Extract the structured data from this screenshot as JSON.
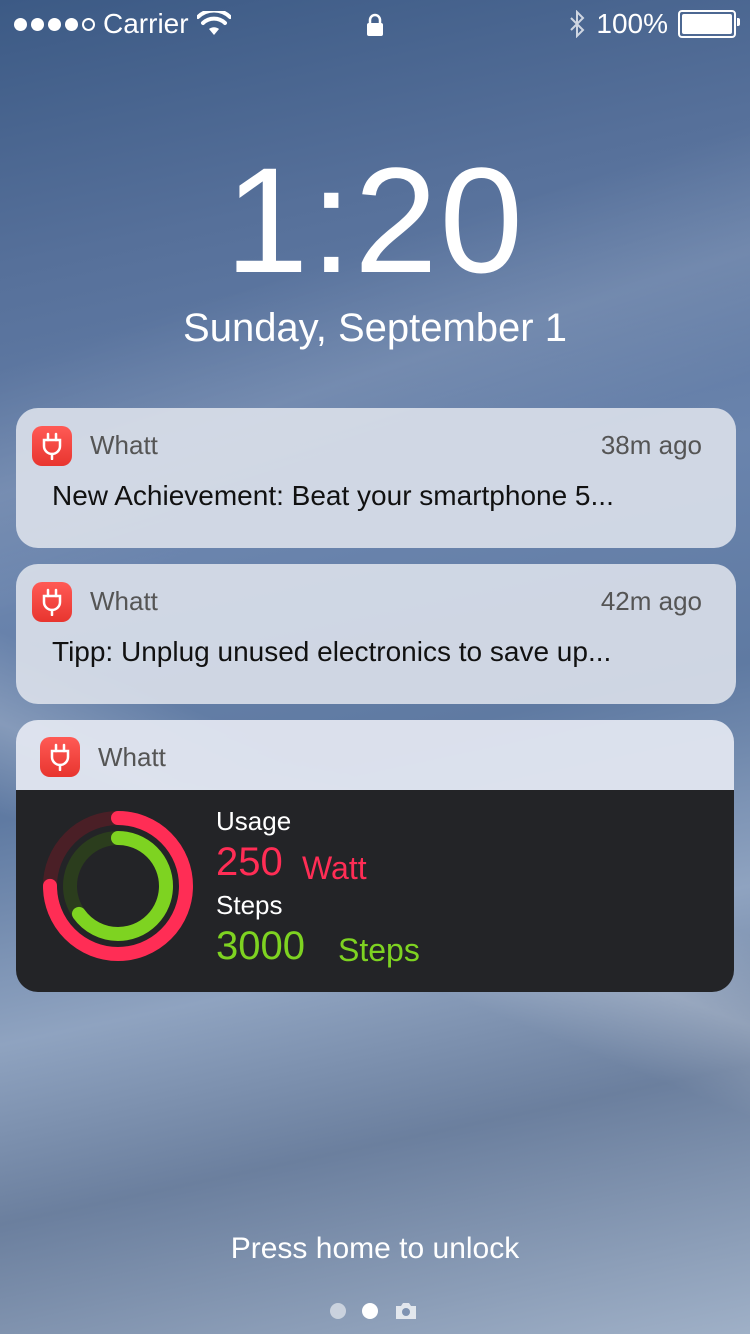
{
  "status_bar": {
    "carrier": "Carrier",
    "battery": "100%",
    "signal_bars": 4,
    "signal_total": 5
  },
  "lock": {
    "time": "1:20",
    "date": "Sunday, September 1",
    "unlock_hint": "Press home to unlock"
  },
  "notifications": [
    {
      "app": "Whatt",
      "time": "38m ago",
      "message": "New Achievement: Beat your smartphone 5..."
    },
    {
      "app": "Whatt",
      "time": "42m ago",
      "message": "Tipp: Unplug unused electronics to save up..."
    }
  ],
  "widget": {
    "app": "Whatt",
    "usage_label": "Usage",
    "usage_value": "250",
    "usage_unit": "Watt",
    "steps_label": "Steps",
    "steps_value": "3000",
    "steps_unit": "Steps",
    "usage_color": "#ff2d55",
    "steps_color": "#7ed321",
    "usage_progress": 0.75,
    "steps_progress": 0.65
  },
  "pager": {
    "pages": 2,
    "active": 1
  }
}
